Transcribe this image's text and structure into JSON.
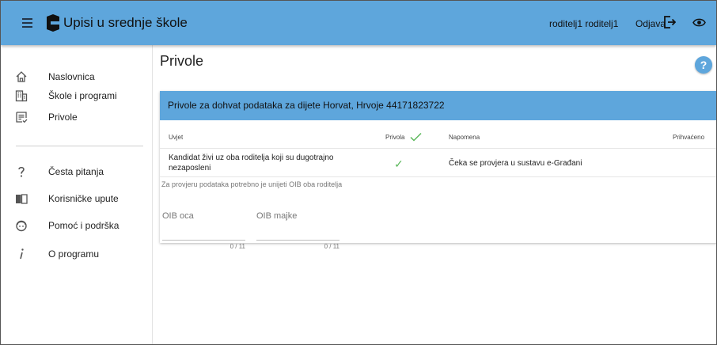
{
  "header": {
    "app_title": "Upisi u srednje škole",
    "user_name": "roditelj1 roditelj1",
    "logout_label": "Odjava",
    "colors": {
      "bar": "#5ea6dc",
      "text": "#111111"
    }
  },
  "sidebar": {
    "items": [
      {
        "label": "Naslovnica",
        "icon": "home-icon"
      },
      {
        "label": "Škole i programi",
        "icon": "building-icon"
      },
      {
        "label": "Privole",
        "icon": "form-icon"
      },
      {
        "label": "Česta pitanja",
        "icon": "question-icon"
      },
      {
        "label": "Korisničke upute",
        "icon": "book-icon"
      },
      {
        "label": "Pomoć i podrška",
        "icon": "support-icon"
      },
      {
        "label": "O programu",
        "icon": "info-icon"
      }
    ]
  },
  "main": {
    "page_title": "Privole",
    "help_label": "?",
    "card": {
      "title": "Privole za dohvat podataka za dijete Horvat, Hrvoje 44171823722",
      "columns": [
        "Uvjet",
        "Privola",
        "Napomena",
        "Prihvaćeno"
      ],
      "rows": [
        {
          "uvjet": "Kandidat živi uz oba roditelja koji su dugotrajno nezaposleni",
          "privola": "✓",
          "napomena": "Čeka se provjera u sustavu e-Građani",
          "prihvaceno": ""
        }
      ],
      "hint": "Za provjeru podataka potrebno je unijeti OIB oba roditelja",
      "fields": [
        {
          "label": "OIB oca",
          "value": "",
          "counter": "0 / 11"
        },
        {
          "label": "OIB majke",
          "value": "",
          "counter": "0 / 11"
        }
      ]
    }
  }
}
